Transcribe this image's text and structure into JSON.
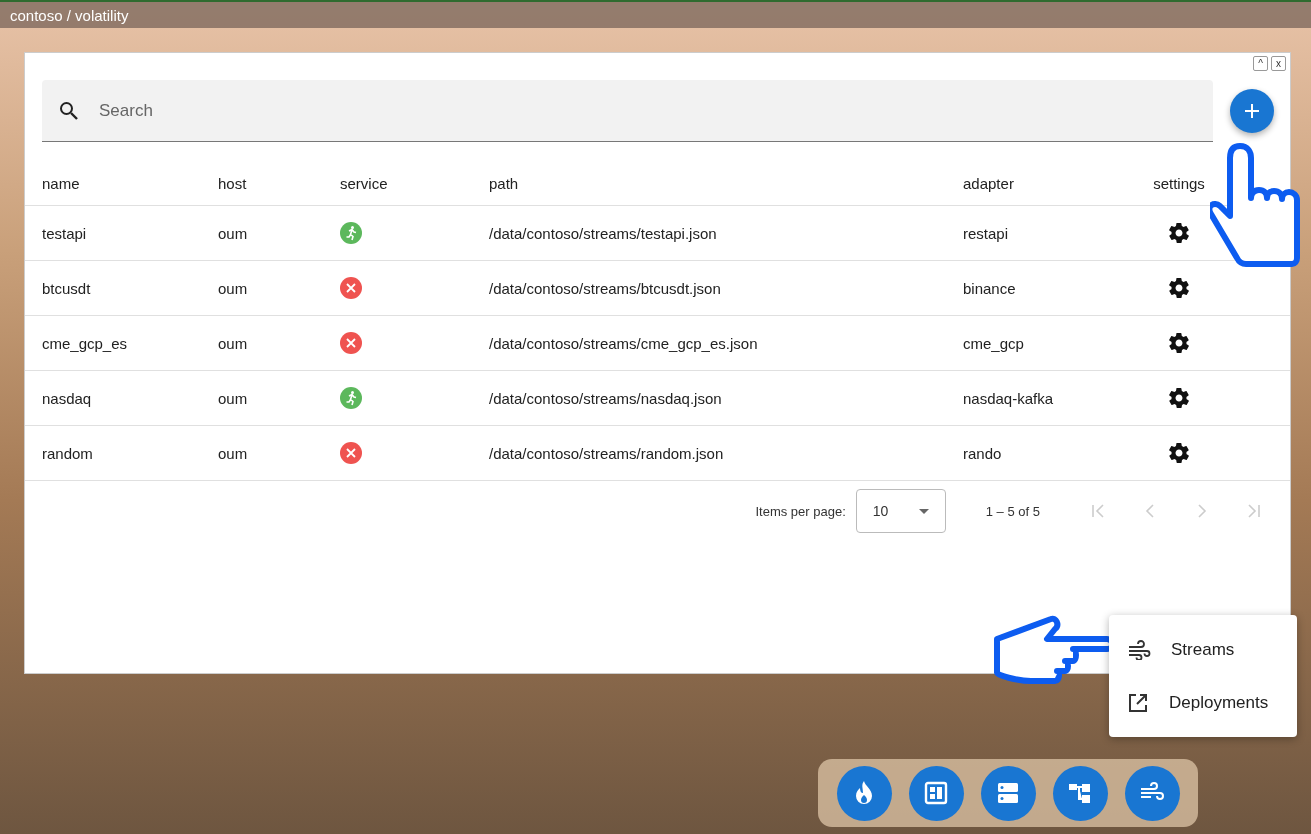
{
  "top_bar": {
    "title": "contoso / volatility"
  },
  "window": {
    "controls": [
      "^",
      "x"
    ],
    "search": {
      "placeholder": "Search"
    },
    "table": {
      "columns": [
        "name",
        "host",
        "service",
        "path",
        "adapter",
        "settings"
      ],
      "rows": [
        {
          "name": "testapi",
          "host": "oum",
          "running": true,
          "path": "/data/contoso/streams/testapi.json",
          "adapter": "restapi"
        },
        {
          "name": "btcusdt",
          "host": "oum",
          "running": false,
          "path": "/data/contoso/streams/btcusdt.json",
          "adapter": "binance"
        },
        {
          "name": "cme_gcp_es",
          "host": "oum",
          "running": false,
          "path": "/data/contoso/streams/cme_gcp_es.json",
          "adapter": "cme_gcp"
        },
        {
          "name": "nasdaq",
          "host": "oum",
          "running": true,
          "path": "/data/contoso/streams/nasdaq.json",
          "adapter": "nasdaq-kafka"
        },
        {
          "name": "random",
          "host": "oum",
          "running": false,
          "path": "/data/contoso/streams/random.json",
          "adapter": "rando"
        }
      ]
    },
    "paginator": {
      "label": "Items per page:",
      "page_size": "10",
      "range": "1 – 5 of 5",
      "buttons": [
        {
          "kind": "first",
          "disabled": true
        },
        {
          "kind": "prev",
          "disabled": true
        },
        {
          "kind": "next",
          "disabled": true
        },
        {
          "kind": "last",
          "disabled": true
        }
      ]
    }
  },
  "menu": [
    {
      "kind": "wind",
      "label": "Streams"
    },
    {
      "kind": "external",
      "label": "Deployments"
    }
  ],
  "dock": [
    {
      "kind": "flame"
    },
    {
      "kind": "dashboard"
    },
    {
      "kind": "server"
    },
    {
      "kind": "hierarchy"
    },
    {
      "kind": "wind"
    }
  ]
}
